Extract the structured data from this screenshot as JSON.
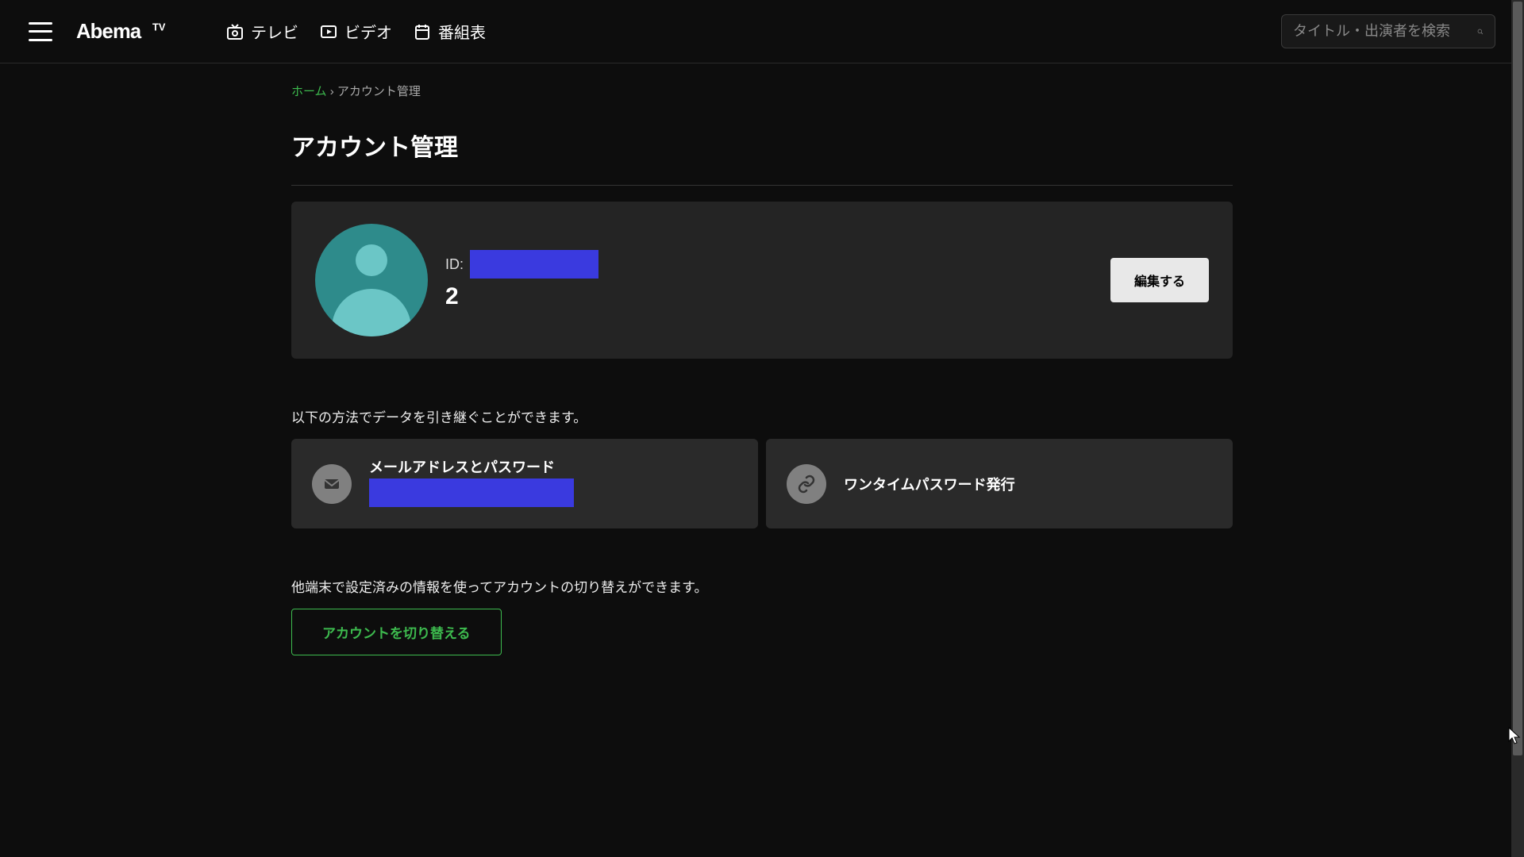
{
  "header": {
    "logo_text": "AbemaTV",
    "nav": [
      {
        "icon": "tv",
        "label": "テレビ"
      },
      {
        "icon": "video",
        "label": "ビデオ"
      },
      {
        "icon": "schedule",
        "label": "番組表"
      }
    ],
    "search": {
      "placeholder": "タイトル・出演者を検索"
    }
  },
  "breadcrumb": {
    "home": "ホーム",
    "current": "アカウント管理"
  },
  "page_title": "アカウント管理",
  "account": {
    "id_label": "ID:",
    "name": "2",
    "edit_label": "編集する"
  },
  "inherit_description": "以下の方法でデータを引き継ぐことができます。",
  "methods": {
    "email": {
      "title": "メールアドレスとパスワード"
    },
    "otp": {
      "title": "ワンタイムパスワード発行"
    }
  },
  "switch_description": "他端末で設定済みの情報を使ってアカウントの切り替えができます。",
  "switch_button": "アカウントを切り替える"
}
